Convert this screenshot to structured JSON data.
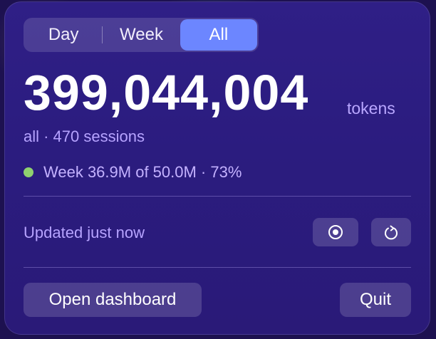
{
  "range_tabs": [
    {
      "label": "Day",
      "active": false
    },
    {
      "label": "Week",
      "active": false
    },
    {
      "label": "All",
      "active": true
    }
  ],
  "total": {
    "value": "399,044,004",
    "unit": "tokens"
  },
  "summary": "all · 470 sessions",
  "week_status": {
    "text": "Week 36.9M of 50.0M · 73%",
    "dot_color": "#8fd16f"
  },
  "updated": "Updated just now",
  "toolbar": {
    "record_icon": "record-icon",
    "refresh_icon": "refresh-icon"
  },
  "actions": {
    "open_dashboard": "Open dashboard",
    "quit": "Quit"
  },
  "colors": {
    "accent": "#6c86ff",
    "panel": "#2d1e84",
    "muted_text": "#b6a3ff"
  }
}
